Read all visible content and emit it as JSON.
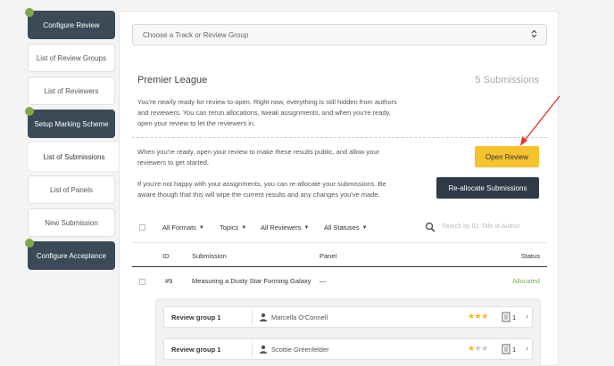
{
  "sidebar": {
    "items": [
      {
        "label": "Configure Review"
      },
      {
        "label": "List of Review Groups"
      },
      {
        "label": "List of Reviewers"
      },
      {
        "label": "Setup Marking Scheme"
      },
      {
        "label": "List of Submissions"
      },
      {
        "label": "List of Panels"
      },
      {
        "label": "New Submission"
      },
      {
        "label": "Configure Acceptance"
      }
    ]
  },
  "main": {
    "track_select_placeholder": "Choose a Track or Review Group",
    "league_title": "Premier League",
    "submissions_count": "5 Submissions",
    "intro_text": "You're nearly ready for review to open. Right now, everything is still hidden from authors and reviewers. You can rerun allocations, tweak assignments, and when you're ready, open your review to let the reviewers in.",
    "open_text": "When you're ready, open your review to make these results public, and allow your reviewers to get started.",
    "realloc_text": "If you're not happy with your assignments, you can re-allocate your submissions. Be aware though that this will wipe the current results and any changes you've made.",
    "open_button": "Open Review",
    "realloc_button": "Re-allocate Submissions"
  },
  "filters": {
    "formats": "All Formats",
    "topics": "Topics",
    "reviewers": "All Reviewers",
    "statuses": "All Statuses",
    "search_placeholder": "Search by ID, Title or Author"
  },
  "table": {
    "headers": {
      "id": "ID",
      "submission": "Submission",
      "panel": "Panel",
      "status": "Status"
    },
    "row": {
      "id": "#9",
      "title": "Measuring a Dusty Star Forming Galaxy",
      "panel": "—",
      "status": "Allocated"
    },
    "groups": [
      {
        "group": "Review group 1",
        "reviewer": "Marcella O'Connell",
        "rating": 3,
        "count": "1"
      },
      {
        "group": "Review group 1",
        "reviewer": "Scottie Greenfelder",
        "rating": 1,
        "count": "1"
      }
    ]
  },
  "colors": {
    "sidebar_dark": "#3c4a57",
    "status_dot": "#7ea84a",
    "open_button": "#f6c22d",
    "realloc_button": "#2e3b47",
    "annotation_arrow": "#e53935"
  }
}
